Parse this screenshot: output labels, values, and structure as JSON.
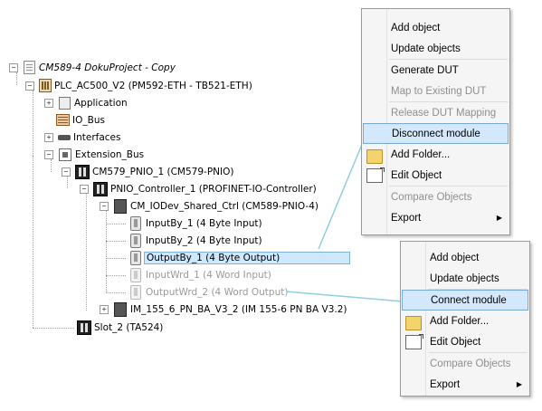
{
  "tree": {
    "project": "CM589-4 DokuProject - Copy",
    "plc": "PLC_AC500_V2 (PM592-ETH - TB521-ETH)",
    "application": "Application",
    "io_bus": "IO_Bus",
    "interfaces": "Interfaces",
    "extension_bus": "Extension_Bus",
    "cm579": "CM579_PNIO_1 (CM579-PNIO)",
    "pnio_controller": "PNIO_Controller_1 (PROFINET-IO-Controller)",
    "cm_iodev": "CM_IODev_Shared_Ctrl (CM589-PNIO-4)",
    "input1": "InputBy_1 (4 Byte Input)",
    "input2": "InputBy_2 (4 Byte Input)",
    "output1": "OutputBy_1 (4 Byte Output)",
    "inputwrd1": "InputWrd_1 (4 Word Input)",
    "outputwrd2": "OutputWrd_2 (4 Word Output)",
    "im155": "IM_155_6_PN_BA_V3_2 (IM 155-6 PN BA V3.2)",
    "slot2": "Slot_2 (TA524)",
    "expander_plus": "+",
    "expander_minus": "−"
  },
  "menu_top": {
    "items": [
      "Add object",
      "Update objects",
      "Generate DUT",
      "Map to Existing DUT",
      "Release DUT Mapping",
      "Disconnect module",
      "Add Folder...",
      "Edit Object",
      "Compare Objects",
      "Export"
    ]
  },
  "menu_bottom": {
    "items": [
      "Add object",
      "Update objects",
      "Connect module",
      "Add Folder...",
      "Edit Object",
      "Compare Objects",
      "Export"
    ]
  },
  "submenu_arrow": "▶",
  "colors": {
    "selection": "#cde8ff",
    "highlight": "#d4e8fb",
    "connector": "#8fcfe0"
  }
}
